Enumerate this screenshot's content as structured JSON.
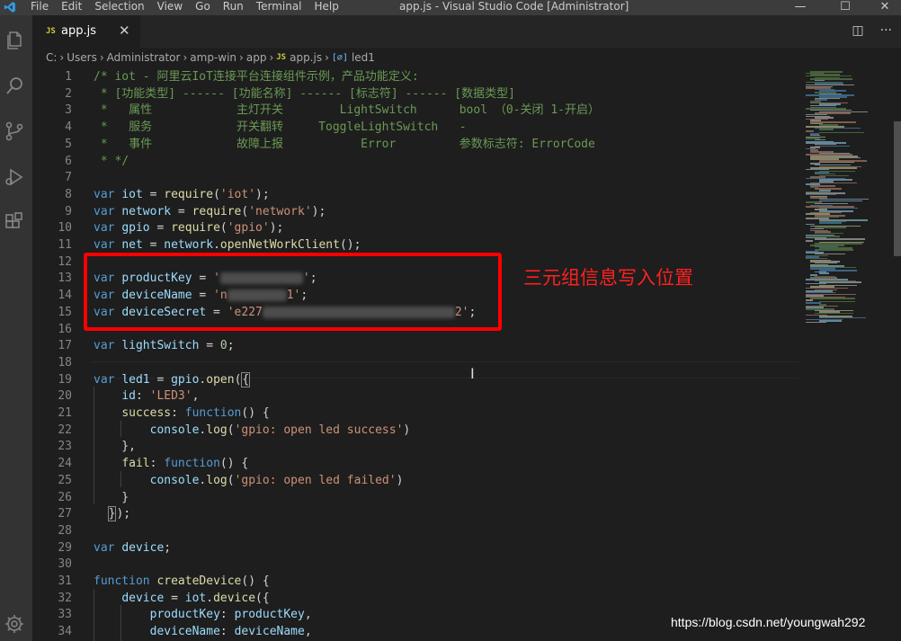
{
  "titlebar": {
    "menu": [
      "File",
      "Edit",
      "Selection",
      "View",
      "Go",
      "Run",
      "Terminal",
      "Help"
    ],
    "title": "app.js - Visual Studio Code [Administrator]",
    "controls": {
      "minimize": "—",
      "maximize": "☐",
      "close": "✕"
    }
  },
  "activity": [
    "explorer-icon",
    "search-icon",
    "source-control-icon",
    "run-debug-icon",
    "extensions-icon",
    "manage-gear-icon"
  ],
  "tab": {
    "icon": "JS",
    "name": "app.js",
    "close": "✕"
  },
  "tab_actions": {
    "split": "◫",
    "more": "···"
  },
  "breadcrumb": [
    "C:",
    "Users",
    "Administrator",
    "amp-win",
    "app"
  ],
  "breadcrumb_file": {
    "icon": "JS",
    "name": "app.js"
  },
  "breadcrumb_symbol": {
    "icon": "[∅]",
    "name": "led1"
  },
  "code": [
    {
      "n": "1",
      "t": [
        [
          "cm",
          "/* iot - 阿里云IoT连接平台连接组件示例，产品功能定义:"
        ]
      ]
    },
    {
      "n": "2",
      "t": [
        [
          "cm",
          " * [功能类型] ------ [功能名称] ------ [标志符] ------ [数据类型]"
        ]
      ]
    },
    {
      "n": "3",
      "t": [
        [
          "cm",
          " *   属性            主灯开关        LightSwitch      bool （0-关闭 1-开启）"
        ]
      ]
    },
    {
      "n": "4",
      "t": [
        [
          "cm",
          " *   服务            开关翻转     ToggleLightSwitch   -"
        ]
      ]
    },
    {
      "n": "5",
      "t": [
        [
          "cm",
          " *   事件            故障上报           Error         参数标志符: ErrorCode"
        ]
      ]
    },
    {
      "n": "6",
      "t": [
        [
          "cm",
          " * */"
        ]
      ]
    },
    {
      "n": "7",
      "t": []
    },
    {
      "n": "8",
      "t": [
        [
          "kw",
          "var "
        ],
        [
          "var",
          "iot"
        ],
        [
          "pl",
          " = "
        ],
        [
          "fn",
          "require"
        ],
        [
          "pl",
          "("
        ],
        [
          "str",
          "'iot'"
        ],
        [
          "pl",
          ");"
        ]
      ]
    },
    {
      "n": "9",
      "t": [
        [
          "kw",
          "var "
        ],
        [
          "var",
          "network"
        ],
        [
          "pl",
          " = "
        ],
        [
          "fn",
          "require"
        ],
        [
          "pl",
          "("
        ],
        [
          "str",
          "'network'"
        ],
        [
          "pl",
          ");"
        ]
      ]
    },
    {
      "n": "10",
      "t": [
        [
          "kw",
          "var "
        ],
        [
          "var",
          "gpio"
        ],
        [
          "pl",
          " = "
        ],
        [
          "fn",
          "require"
        ],
        [
          "pl",
          "("
        ],
        [
          "str",
          "'gpio'"
        ],
        [
          "pl",
          ");"
        ]
      ]
    },
    {
      "n": "11",
      "t": [
        [
          "kw",
          "var "
        ],
        [
          "var",
          "net"
        ],
        [
          "pl",
          " = "
        ],
        [
          "var",
          "network"
        ],
        [
          "pl",
          "."
        ],
        [
          "fn",
          "openNetWorkClient"
        ],
        [
          "pl",
          "();"
        ]
      ]
    },
    {
      "n": "12",
      "t": []
    },
    {
      "n": "13",
      "t": [
        [
          "kw",
          "var "
        ],
        [
          "var",
          "productKey"
        ],
        [
          "pl",
          " = "
        ],
        [
          "str",
          "'"
        ],
        [
          "blur",
          "92"
        ],
        [
          "str",
          "'"
        ],
        [
          "pl",
          ";"
        ]
      ]
    },
    {
      "n": "14",
      "t": [
        [
          "kw",
          "var "
        ],
        [
          "var",
          "deviceName"
        ],
        [
          "pl",
          " = "
        ],
        [
          "str",
          "'n"
        ],
        [
          "blur",
          "66"
        ],
        [
          "str",
          "1'"
        ],
        [
          "pl",
          ";"
        ]
      ]
    },
    {
      "n": "15",
      "t": [
        [
          "kw",
          "var "
        ],
        [
          "var",
          "deviceSecret"
        ],
        [
          "pl",
          " = "
        ],
        [
          "str",
          "'e227"
        ],
        [
          "blur",
          "214"
        ],
        [
          "str",
          "2'"
        ],
        [
          "pl",
          ";"
        ]
      ]
    },
    {
      "n": "16",
      "t": []
    },
    {
      "n": "17",
      "t": [
        [
          "kw",
          "var "
        ],
        [
          "var",
          "lightSwitch"
        ],
        [
          "pl",
          " = "
        ],
        [
          "num",
          "0"
        ],
        [
          "pl",
          ";"
        ]
      ]
    },
    {
      "n": "18",
      "t": []
    },
    {
      "n": "19",
      "t": [
        [
          "kw",
          "var "
        ],
        [
          "var",
          "led1"
        ],
        [
          "pl",
          " = "
        ],
        [
          "var",
          "gpio"
        ],
        [
          "pl",
          "."
        ],
        [
          "fn",
          "open"
        ],
        [
          "pl",
          "("
        ],
        [
          "brk",
          "{"
        ]
      ]
    },
    {
      "n": "20",
      "t": [
        [
          "pl",
          "    "
        ],
        [
          "var",
          "id"
        ],
        [
          "pl",
          ": "
        ],
        [
          "str",
          "'LED3'"
        ],
        [
          "pl",
          ","
        ]
      ]
    },
    {
      "n": "21",
      "t": [
        [
          "pl",
          "    "
        ],
        [
          "fn",
          "success"
        ],
        [
          "pl",
          ": "
        ],
        [
          "kw",
          "function"
        ],
        [
          "pl",
          "() {"
        ]
      ]
    },
    {
      "n": "22",
      "t": [
        [
          "pl",
          "        "
        ],
        [
          "var",
          "console"
        ],
        [
          "pl",
          "."
        ],
        [
          "fn",
          "log"
        ],
        [
          "pl",
          "("
        ],
        [
          "str",
          "'gpio: open led success'"
        ],
        [
          "pl",
          ")"
        ]
      ]
    },
    {
      "n": "23",
      "t": [
        [
          "pl",
          "    },"
        ]
      ]
    },
    {
      "n": "24",
      "t": [
        [
          "pl",
          "    "
        ],
        [
          "fn",
          "fail"
        ],
        [
          "pl",
          ": "
        ],
        [
          "kw",
          "function"
        ],
        [
          "pl",
          "() {"
        ]
      ]
    },
    {
      "n": "25",
      "t": [
        [
          "pl",
          "        "
        ],
        [
          "var",
          "console"
        ],
        [
          "pl",
          "."
        ],
        [
          "fn",
          "log"
        ],
        [
          "pl",
          "("
        ],
        [
          "str",
          "'gpio: open led failed'"
        ],
        [
          "pl",
          ")"
        ]
      ]
    },
    {
      "n": "26",
      "t": [
        [
          "pl",
          "    }"
        ]
      ]
    },
    {
      "n": "27",
      "t": [
        [
          "pl",
          "  "
        ],
        [
          "brk",
          "}"
        ],
        [
          "pl",
          ");"
        ]
      ]
    },
    {
      "n": "28",
      "t": []
    },
    {
      "n": "29",
      "t": [
        [
          "kw",
          "var "
        ],
        [
          "var",
          "device"
        ],
        [
          "pl",
          ";"
        ]
      ]
    },
    {
      "n": "30",
      "t": []
    },
    {
      "n": "31",
      "t": [
        [
          "kw",
          "function "
        ],
        [
          "fn",
          "createDevice"
        ],
        [
          "pl",
          "() {"
        ]
      ]
    },
    {
      "n": "32",
      "t": [
        [
          "pl",
          "    "
        ],
        [
          "var",
          "device"
        ],
        [
          "pl",
          " = "
        ],
        [
          "var",
          "iot"
        ],
        [
          "pl",
          "."
        ],
        [
          "fn",
          "device"
        ],
        [
          "pl",
          "({"
        ]
      ]
    },
    {
      "n": "33",
      "t": [
        [
          "pl",
          "        "
        ],
        [
          "var",
          "productKey"
        ],
        [
          "pl",
          ": "
        ],
        [
          "var",
          "productKey"
        ],
        [
          "pl",
          ","
        ]
      ]
    },
    {
      "n": "34",
      "t": [
        [
          "pl",
          "        "
        ],
        [
          "var",
          "deviceName"
        ],
        [
          "pl",
          ": "
        ],
        [
          "var",
          "deviceName"
        ],
        [
          "pl",
          ","
        ]
      ]
    }
  ],
  "annotation": "三元组信息写入位置",
  "watermark": "https://blog.csdn.net/youngwah292",
  "colors": {
    "comment": "#6a9955",
    "keyword": "#569cd6",
    "variable": "#9cdcfe",
    "function": "#dcdcaa",
    "string": "#ce9178",
    "number": "#b5cea8",
    "annotation": "#ff0000"
  }
}
